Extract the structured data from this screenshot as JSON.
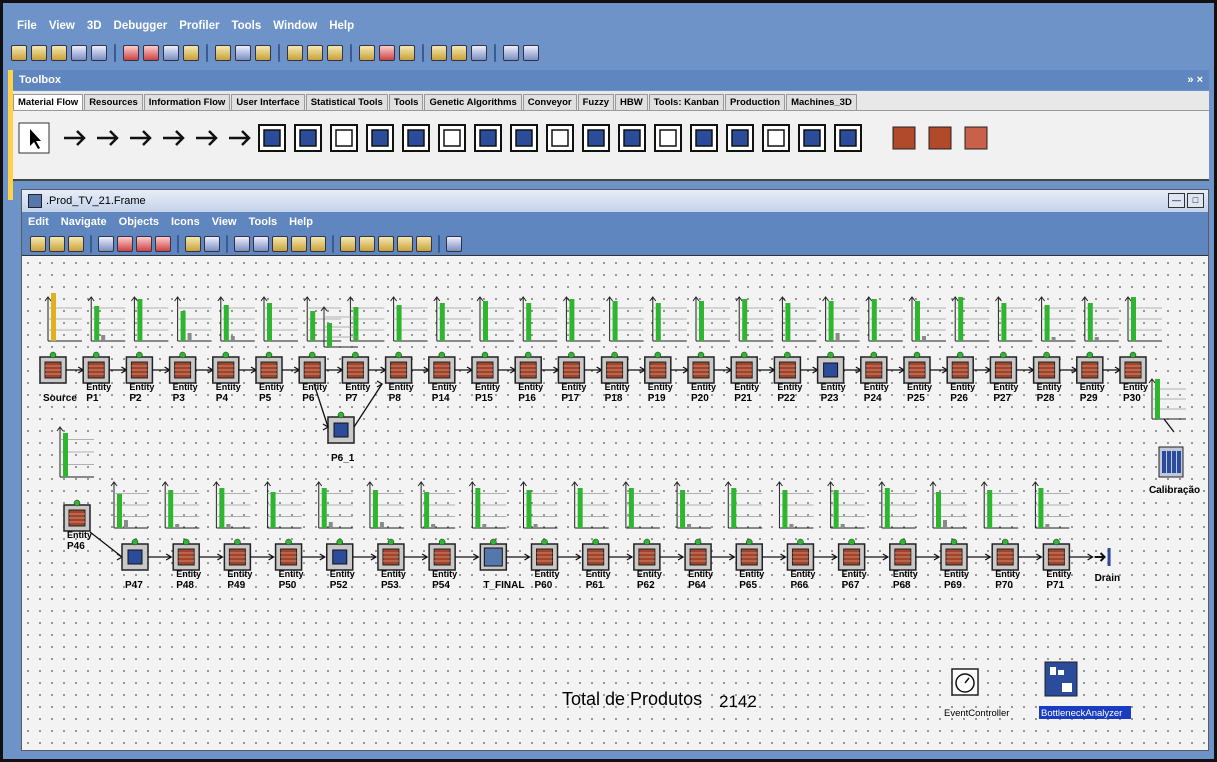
{
  "menubar": [
    "File",
    "View",
    "3D",
    "Debugger",
    "Profiler",
    "Tools",
    "Window",
    "Help"
  ],
  "toolbox": {
    "title": "Toolbox",
    "pin": "» ×",
    "tabs": [
      "Material Flow",
      "Resources",
      "Information Flow",
      "User Interface",
      "Statistical Tools",
      "Tools",
      "Genetic Algorithms",
      "Conveyor",
      "Fuzzy",
      "HBW",
      "Tools: Kanban",
      "Production",
      "Machines_3D"
    ],
    "active_tab": "Material Flow"
  },
  "frame": {
    "title": ".Prod_TV_21.Frame",
    "menu": [
      "Edit",
      "Navigate",
      "Objects",
      "Icons",
      "View",
      "Tools",
      "Help"
    ]
  },
  "model": {
    "entity_label": "Entity",
    "row1": [
      "Source",
      "P1",
      "P2",
      "P3",
      "P4",
      "P5",
      "P6",
      "P7",
      "P8",
      "P14",
      "P15",
      "P16",
      "P17",
      "P18",
      "P19",
      "P20",
      "P21",
      "P22",
      "P23",
      "P24",
      "P25",
      "P26",
      "P27",
      "P28",
      "P29",
      "P30"
    ],
    "row1_extra": "P6_1",
    "calib": "Calibração",
    "row2": [
      "P46",
      "P47",
      "P48",
      "P49",
      "P50",
      "P52",
      "P53",
      "P54",
      "T_FINAL",
      "P60",
      "P61",
      "P62",
      "P64",
      "P65",
      "P66",
      "P67",
      "P68",
      "P69",
      "P70",
      "P71",
      "Drain"
    ],
    "total_label": "Total de Produtos",
    "total_value": "2142",
    "event_controller": "EventController",
    "bottleneck": "BottleneckAnalyzer"
  }
}
